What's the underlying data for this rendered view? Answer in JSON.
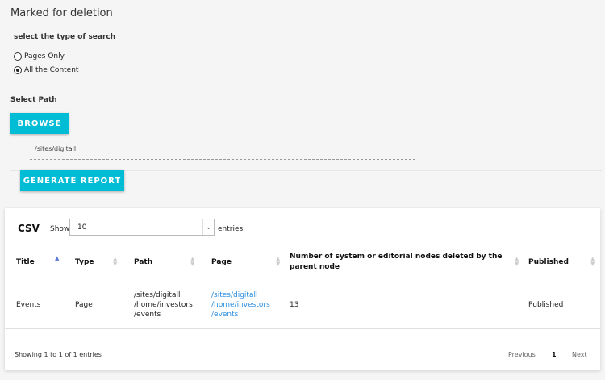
{
  "page": {
    "title": "Marked for deletion"
  },
  "search_type": {
    "label": "select the type of search",
    "options": [
      {
        "label": "Pages Only",
        "checked": false
      },
      {
        "label": "All the Content",
        "checked": true
      }
    ]
  },
  "path": {
    "label": "Select Path",
    "browse_label": "BROWSE",
    "value": "/sites/digitall",
    "generate_label": "GENERATE REPORT"
  },
  "table_controls": {
    "csv_label": "CSV",
    "show_label": "Show",
    "entries_value": "10",
    "entries_label": "entries"
  },
  "table": {
    "headers": {
      "title": "Title",
      "type": "Type",
      "path": "Path",
      "page": "Page",
      "count": "Number of system or editorial nodes deleted by the parent node",
      "published": "Published"
    },
    "rows": [
      {
        "title": "Events",
        "type": "Page",
        "path": [
          "/sites/digitall",
          "/home/investors",
          "/events"
        ],
        "page": [
          "/sites/digitall",
          "/home/investors",
          "/events"
        ],
        "count": "13",
        "published": "Published"
      }
    ]
  },
  "footer": {
    "info": "Showing 1 to 1 of 1 entries",
    "previous": "Previous",
    "current_page": "1",
    "next": "Next"
  },
  "colors": {
    "accent": "#00bcd4",
    "link": "#2a8de0",
    "sort_active": "#5a7bd6"
  }
}
